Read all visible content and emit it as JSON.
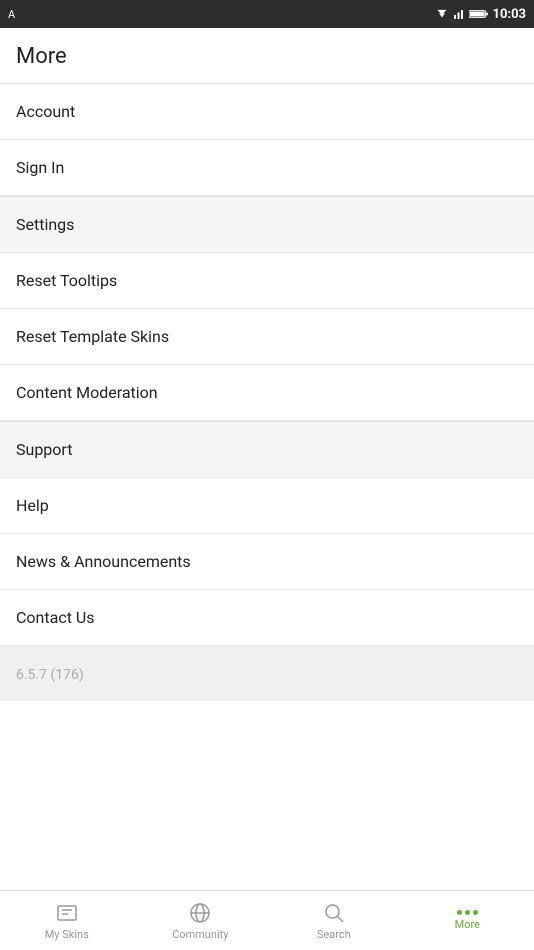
{
  "statusBar": {
    "time": "10:03",
    "appIcon": "A"
  },
  "pageTitle": "More",
  "menuItems": [
    {
      "id": "account",
      "label": "Account",
      "separator": false
    },
    {
      "id": "sign-in",
      "label": "Sign In",
      "separator": false
    },
    {
      "id": "settings",
      "label": "Settings",
      "separator": true
    },
    {
      "id": "reset-tooltips",
      "label": "Reset Tooltips",
      "separator": false
    },
    {
      "id": "reset-template-skins",
      "label": "Reset Template Skins",
      "separator": false
    },
    {
      "id": "content-moderation",
      "label": "Content Moderation",
      "separator": false
    },
    {
      "id": "support",
      "label": "Support",
      "separator": true
    },
    {
      "id": "help",
      "label": "Help",
      "separator": false
    },
    {
      "id": "news-announcements",
      "label": "News & Announcements",
      "separator": false
    },
    {
      "id": "contact-us",
      "label": "Contact Us",
      "separator": false
    }
  ],
  "version": "6.5.7 (176)",
  "bottomNav": {
    "items": [
      {
        "id": "my-skins",
        "label": "My Skins",
        "active": false
      },
      {
        "id": "community",
        "label": "Community",
        "active": false
      },
      {
        "id": "search",
        "label": "Search",
        "active": false
      },
      {
        "id": "more",
        "label": "More",
        "active": true
      }
    ]
  }
}
